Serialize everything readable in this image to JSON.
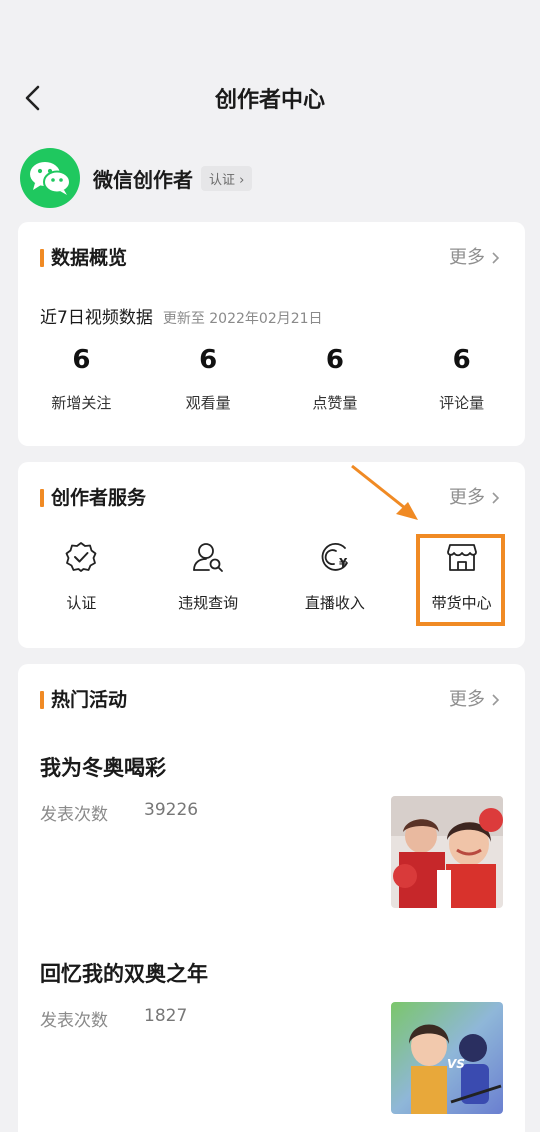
{
  "nav": {
    "title": "创作者中心"
  },
  "account": {
    "name": "微信创作者",
    "verify_label": "认证"
  },
  "overview": {
    "title": "数据概览",
    "more": "更多",
    "subtitle": "近7日视频数据",
    "updated": "更新至 2022年02月21日",
    "stats": [
      {
        "value": "6",
        "label": "新增关注"
      },
      {
        "value": "6",
        "label": "观看量"
      },
      {
        "value": "6",
        "label": "点赞量"
      },
      {
        "value": "6",
        "label": "评论量"
      }
    ]
  },
  "services": {
    "title": "创作者服务",
    "more": "更多",
    "items": [
      {
        "label": "认证",
        "icon": "badge-check-icon"
      },
      {
        "label": "违规查询",
        "icon": "user-search-icon"
      },
      {
        "label": "直播收入",
        "icon": "live-income-icon"
      },
      {
        "label": "带货中心",
        "icon": "shop-icon"
      }
    ],
    "highlight_color": "#f08a24"
  },
  "events": {
    "title": "热门活动",
    "more": "更多",
    "items": [
      {
        "title": "我为冬奥喝彩",
        "meta_label": "发表次数",
        "count": "39226"
      },
      {
        "title": "回忆我的双奥之年",
        "meta_label": "发表次数",
        "count": "1827"
      }
    ]
  },
  "colors": {
    "accent": "#f08a24",
    "wechat_green": "#1fc85f",
    "background": "#f1f1f3"
  }
}
